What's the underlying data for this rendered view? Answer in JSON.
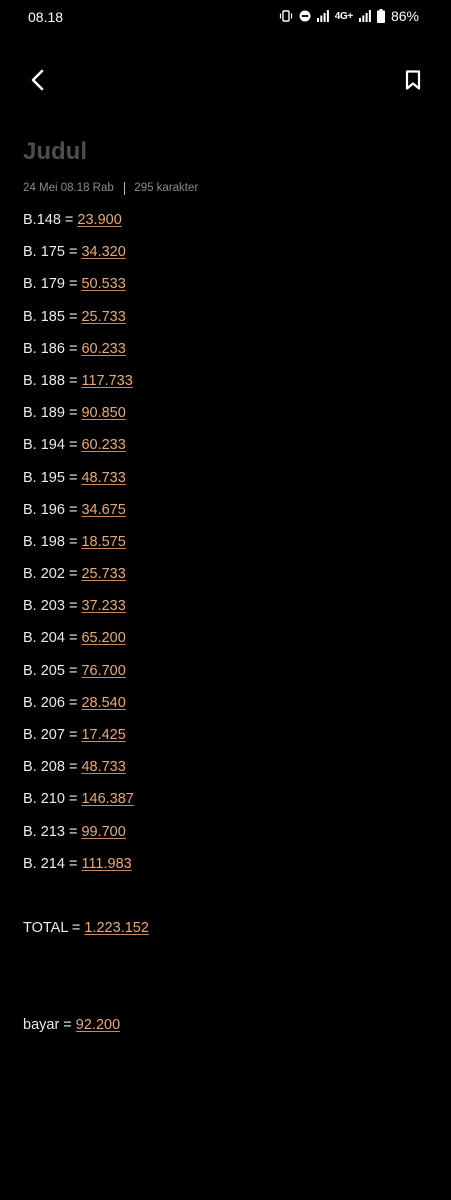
{
  "status": {
    "time": "08.18",
    "network": "4G+",
    "battery": "86%"
  },
  "toolbar": {
    "back_icon": "chevron-left-icon",
    "bookmark_icon": "bookmark-icon"
  },
  "note": {
    "title": "Judul",
    "date": "24 Mei 08.18 Rab",
    "char_count": "295 karakter",
    "lines": [
      {
        "label": "B.148 = ",
        "value": "23.900"
      },
      {
        "label": "B. 175 = ",
        "value": "34.320"
      },
      {
        "label": "B. 179 = ",
        "value": "50.533"
      },
      {
        "label": "B. 185 = ",
        "value": "25.733"
      },
      {
        "label": "B. 186 = ",
        "value": "60.233"
      },
      {
        "label": "B. 188 = ",
        "value": "117.733"
      },
      {
        "label": "B. 189 = ",
        "value": "90.850"
      },
      {
        "label": "B. 194 = ",
        "value": "60.233"
      },
      {
        "label": "B. 195 = ",
        "value": "48.733"
      },
      {
        "label": "B. 196 = ",
        "value": "34.675"
      },
      {
        "label": "B. 198 = ",
        "value": "18.575"
      },
      {
        "label": "B. 202 = ",
        "value": "25.733"
      },
      {
        "label": "B. 203 = ",
        "value": "37.233"
      },
      {
        "label": "B. 204 = ",
        "value": "65.200"
      },
      {
        "label": "B. 205 = ",
        "value": "76.700"
      },
      {
        "label": "B. 206 = ",
        "value": "28.540"
      },
      {
        "label": "B. 207 = ",
        "value": "17.425"
      },
      {
        "label": "B. 208 = ",
        "value": "48.733"
      },
      {
        "label": "B. 210 = ",
        "value": "146.387"
      },
      {
        "label": "B. 213 = ",
        "value": "99.700"
      },
      {
        "label": "B. 214 = ",
        "value": "111.983"
      }
    ],
    "total": {
      "label": "TOTAL = ",
      "value": "1.223.152"
    },
    "bayar": {
      "label": "bayar = ",
      "value": "92.200"
    }
  },
  "colors": {
    "background": "#000000",
    "text": "#ececec",
    "link_value": "#e8a97a",
    "title_placeholder": "#4d4d4d",
    "meta": "#8a8a8a"
  }
}
